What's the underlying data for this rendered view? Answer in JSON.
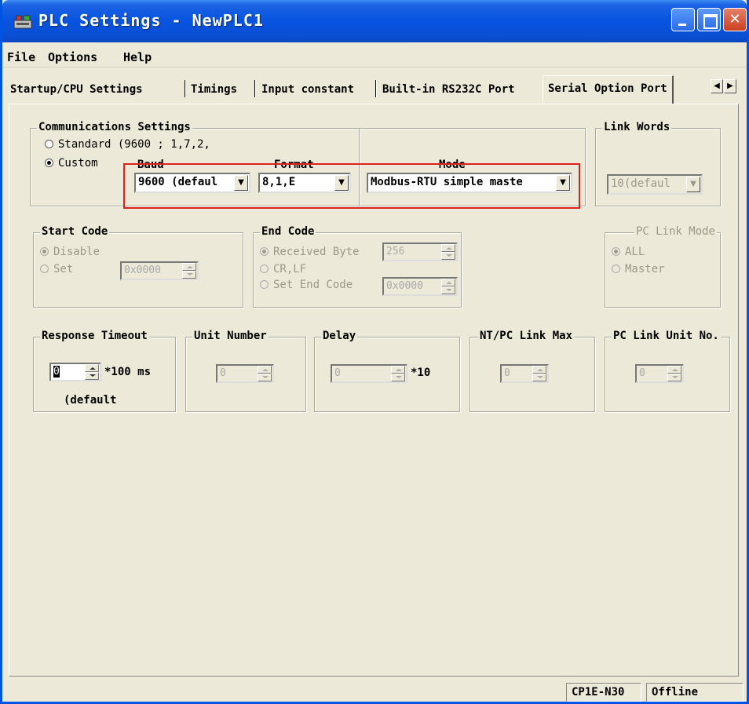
{
  "window": {
    "title": "PLC Settings - NewPLC1"
  },
  "menu": {
    "items": [
      "File",
      "Options",
      "Help"
    ]
  },
  "tabs": {
    "items": [
      "Startup/CPU Settings",
      "Timings",
      "Input constant",
      "Built-in RS232C Port",
      "Serial Option Port"
    ],
    "active": "Serial Option Port"
  },
  "comms": {
    "group_label": "Communications Settings",
    "standard_label": "Standard (9600 ; 1,7,2,",
    "custom_label": "Custom",
    "baud_label": "Baud",
    "baud_value": "9600 (defaul",
    "format_label": "Format",
    "format_value": "8,1,E",
    "mode_label": "Mode",
    "mode_value": "Modbus-RTU simple maste"
  },
  "link_words": {
    "group_label": "Link Words",
    "value": "10(defaul"
  },
  "start_code": {
    "group_label": "Start Code",
    "disable_label": "Disable",
    "set_label": "Set",
    "value": "0x0000"
  },
  "end_code": {
    "group_label": "End Code",
    "received_label": "Received Byte",
    "received_value": "256",
    "crlf_label": "CR,LF",
    "set_end_label": "Set End Code",
    "set_end_value": "0x0000"
  },
  "pc_link_mode": {
    "group_label": "PC Link Mode",
    "all_label": "ALL",
    "master_label": "Master"
  },
  "response_timeout": {
    "group_label": "Response Timeout",
    "value": "0",
    "unit": "*100 ms",
    "note": "(default"
  },
  "unit_number": {
    "group_label": "Unit Number",
    "value": "0"
  },
  "delay": {
    "group_label": "Delay",
    "value": "0",
    "unit": "*10"
  },
  "nt_pc_link_max": {
    "group_label": "NT/PC Link Max",
    "value": "0"
  },
  "pc_link_unit_no": {
    "group_label": "PC Link Unit No.",
    "value": "0"
  },
  "status": {
    "model": "CP1E-N30",
    "connection": "Offline"
  },
  "colors": {
    "highlight": "#e0201a",
    "titlebar": "#0854e0",
    "face": "#ece9d8"
  }
}
